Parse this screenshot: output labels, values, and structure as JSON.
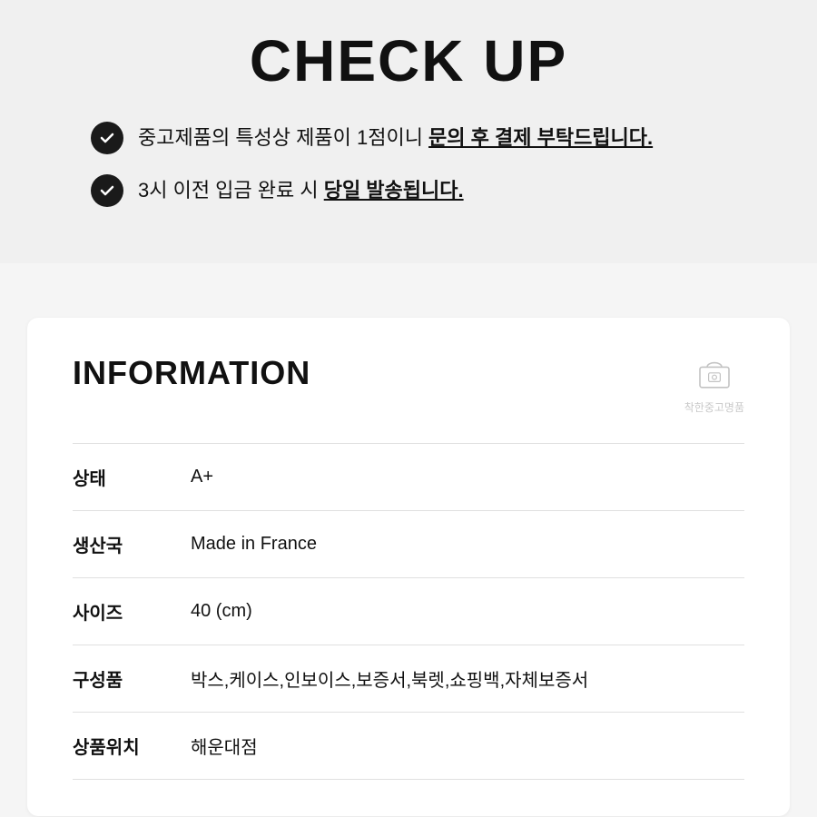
{
  "header": {
    "title": "CHECK UP",
    "checks": [
      {
        "id": "check1",
        "text_before": "중고제품의 특성상 제품이 1점이니 ",
        "text_bold": "문의 후 결제 부탁드립니다.",
        "text_after": ""
      },
      {
        "id": "check2",
        "text_before": "3시 이전 입금 완료 시 ",
        "text_bold": "당일 발송됩니다.",
        "text_after": ""
      }
    ]
  },
  "info": {
    "title": "INFORMATION",
    "watermark_line1": "착한중고명품",
    "watermark_line2": "착한중고명품",
    "rows": [
      {
        "label": "상태",
        "value": "A+"
      },
      {
        "label": "생산국",
        "value": "Made in France"
      },
      {
        "label": "사이즈",
        "value": "40 (cm)"
      },
      {
        "label": "구성품",
        "value": "박스,케이스,인보이스,보증서,북렛,쇼핑백,자체보증서"
      },
      {
        "label": "상품위치",
        "value": "해운대점"
      }
    ]
  }
}
